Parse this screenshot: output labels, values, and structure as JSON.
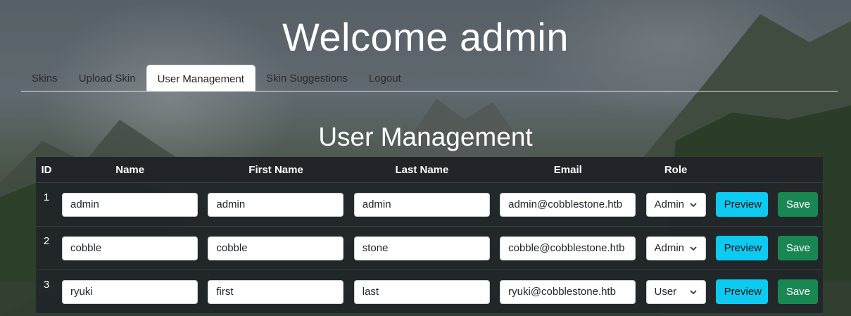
{
  "header": {
    "title": "Welcome admin"
  },
  "tabs": [
    {
      "label": "Skins"
    },
    {
      "label": "Upload Skin"
    },
    {
      "label": "User Management",
      "active": true
    },
    {
      "label": "Skin Suggestions"
    },
    {
      "label": "Logout"
    }
  ],
  "section": {
    "title": "User Management"
  },
  "table": {
    "columns": [
      "ID",
      "Name",
      "First Name",
      "Last Name",
      "Email",
      "Role",
      "",
      ""
    ],
    "rows": [
      {
        "id": "1",
        "name": "admin",
        "first_name": "admin",
        "last_name": "admin",
        "email": "admin@cobblestone.htb",
        "role": "Admin"
      },
      {
        "id": "2",
        "name": "cobble",
        "first_name": "cobble",
        "last_name": "stone",
        "email": "cobble@cobblestone.htb",
        "role": "Admin"
      },
      {
        "id": "3",
        "name": "ryuki",
        "first_name": "first",
        "last_name": "last",
        "email": "ryuki@cobblestone.htb",
        "role": "User"
      }
    ],
    "preview_label": "Preview",
    "save_label": "Save"
  },
  "colors": {
    "preview_button": "#0dcaf0",
    "save_button": "#198754",
    "table_background": "#212529"
  }
}
